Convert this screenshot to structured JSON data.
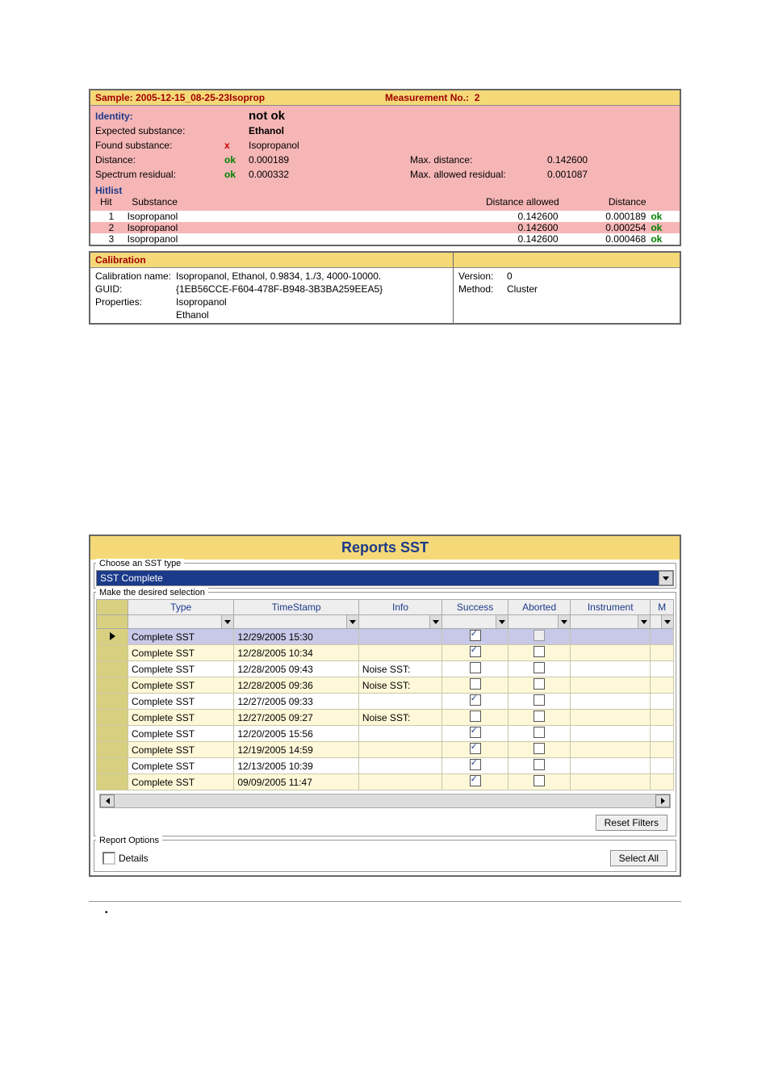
{
  "sample": {
    "label": "Sample:",
    "value": "2005-12-15_08-25-23Isoprop",
    "meas_label": "Measurement No.:",
    "meas_value": "2"
  },
  "identity": {
    "title": "Identity:",
    "title_val": "not ok",
    "rows": [
      {
        "label": "Expected substance:",
        "status": "",
        "value": "Ethanol",
        "bold": true,
        "label2": "",
        "value2": ""
      },
      {
        "label": "Found substance:",
        "status": "x",
        "value": "Isopropanol",
        "label2": "",
        "value2": ""
      },
      {
        "label": "Distance:",
        "status": "ok",
        "value": "0.000189",
        "label2": "Max. distance:",
        "value2": "0.142600"
      },
      {
        "label": "Spectrum residual:",
        "status": "ok",
        "value": "0.000332",
        "label2": "Max. allowed residual:",
        "value2": "0.001087"
      }
    ],
    "hitlist_title": "Hitlist",
    "cols": {
      "hit": "Hit",
      "sub": "Substance",
      "da": "Distance allowed",
      "d": "Distance"
    },
    "hits": [
      {
        "n": "1",
        "sub": "Isopropanol",
        "da": "0.142600",
        "d": "0.000189",
        "ok": "ok"
      },
      {
        "n": "2",
        "sub": "Isopropanol",
        "da": "0.142600",
        "d": "0.000254",
        "ok": "ok"
      },
      {
        "n": "3",
        "sub": "Isopropanol",
        "da": "0.142600",
        "d": "0.000468",
        "ok": "ok"
      }
    ]
  },
  "cal": {
    "title": "Calibration",
    "rows": [
      {
        "l": "Calibration name:",
        "v": "Isopropanol, Ethanol, 0.9834, 1./3, 4000-10000."
      },
      {
        "l": "GUID:",
        "v": "{1EB56CCE-F604-478F-B948-3B3BA259EEA5}"
      },
      {
        "l": "Properties:",
        "v": "Isopropanol"
      },
      {
        "l": "",
        "v": "Ethanol"
      }
    ],
    "right": [
      {
        "l": "Version:",
        "v": "0"
      },
      {
        "l": "Method:",
        "v": "Cluster"
      }
    ]
  },
  "sst": {
    "title": "Reports SST",
    "choose_label": "Choose an SST type",
    "dropdown": "SST Complete",
    "make_label": "Make the desired selection",
    "cols": [
      "Type",
      "TimeStamp",
      "Info",
      "Success",
      "Aborted",
      "Instrument",
      "M"
    ],
    "rows": [
      {
        "sel": true,
        "type": "Complete SST",
        "ts": "12/29/2005 15:30",
        "info": "",
        "ok": true,
        "ab": "flat"
      },
      {
        "type": "Complete SST",
        "ts": "12/28/2005 10:34",
        "info": "",
        "ok": true,
        "ab": false
      },
      {
        "type": "Complete SST",
        "ts": "12/28/2005 09:43",
        "info": "Noise SST:",
        "ok": false,
        "ab": false
      },
      {
        "type": "Complete SST",
        "ts": "12/28/2005 09:36",
        "info": "Noise SST:",
        "ok": false,
        "ab": false
      },
      {
        "type": "Complete SST",
        "ts": "12/27/2005 09:33",
        "info": "",
        "ok": true,
        "ab": false
      },
      {
        "type": "Complete SST",
        "ts": "12/27/2005 09:27",
        "info": "Noise SST:",
        "ok": false,
        "ab": false
      },
      {
        "type": "Complete SST",
        "ts": "12/20/2005 15:56",
        "info": "",
        "ok": true,
        "ab": false
      },
      {
        "type": "Complete SST",
        "ts": "12/19/2005 14:59",
        "info": "",
        "ok": true,
        "ab": false
      },
      {
        "type": "Complete SST",
        "ts": "12/13/2005 10:39",
        "info": "",
        "ok": true,
        "ab": false
      },
      {
        "type": "Complete SST",
        "ts": "09/09/2005 11:47",
        "info": "",
        "ok": true,
        "ab": false
      }
    ],
    "reset": "Reset Filters",
    "options_label": "Report Options",
    "details": "Details",
    "select_all": "Select All"
  }
}
